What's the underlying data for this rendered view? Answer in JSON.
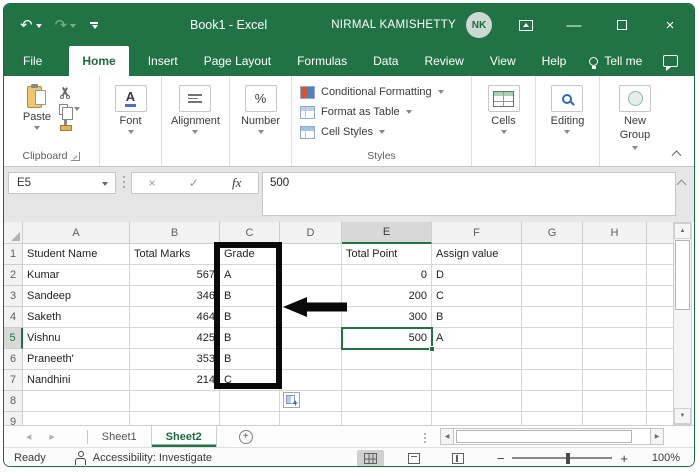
{
  "titlebar": {
    "title": "Book1 - Excel",
    "user": "NIRMAL KAMISHETTY",
    "avatar": "NK"
  },
  "menu": {
    "file": "File",
    "home": "Home",
    "insert": "Insert",
    "page_layout": "Page Layout",
    "formulas": "Formulas",
    "data": "Data",
    "review": "Review",
    "view": "View",
    "help": "Help",
    "tell_me": "Tell me"
  },
  "ribbon": {
    "paste": "Paste",
    "clipboard_label": "Clipboard",
    "font": "Font",
    "font_letter": "A",
    "alignment": "Alignment",
    "number": "Number",
    "percent": "%",
    "styles_items": [
      "Conditional Formatting",
      "Format as Table",
      "Cell Styles"
    ],
    "styles_label": "Styles",
    "cells": "Cells",
    "editing": "Editing",
    "new_group": "New Group"
  },
  "formula_bar": {
    "name_box": "E5",
    "cancel": "×",
    "enter": "✓",
    "fx": "fx",
    "value": "500"
  },
  "grid": {
    "col_headers": [
      "A",
      "B",
      "C",
      "D",
      "E",
      "F",
      "G",
      "H"
    ],
    "row_headers": [
      "1",
      "2",
      "3",
      "4",
      "5",
      "6",
      "7",
      "8",
      "9"
    ],
    "selected_cell": "E5",
    "rows": [
      {
        "a": "Student Name",
        "b": "Total Marks",
        "c": "Grade",
        "e": "Total Point",
        "f": "Assign value"
      },
      {
        "a": "Kumar",
        "b": "567",
        "c": "A",
        "e": "0",
        "f": "D"
      },
      {
        "a": "Sandeep",
        "b": "346",
        "c": "B",
        "e": "200",
        "f": "C"
      },
      {
        "a": "Saketh",
        "b": "464",
        "c": "B",
        "e": "300",
        "f": "B"
      },
      {
        "a": "Vishnu",
        "b": "425",
        "c": "B",
        "e": "500",
        "f": "A"
      },
      {
        "a": "Praneeth'",
        "b": "353",
        "c": "B"
      },
      {
        "a": "Nandhini",
        "b": "214",
        "c": "C"
      }
    ]
  },
  "sheetbar": {
    "sheet1": "Sheet1",
    "sheet2": "Sheet2"
  },
  "statusbar": {
    "ready": "Ready",
    "accessibility": "Accessibility: Investigate",
    "zoom_level": "100%"
  },
  "colors": {
    "excel_green": "#217346",
    "annotation_black": "#0a0a0a"
  }
}
